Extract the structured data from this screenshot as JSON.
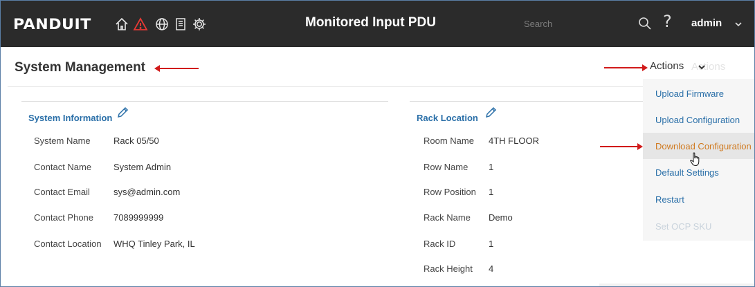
{
  "topbar": {
    "logo": "PANDUIT",
    "nav_icons": [
      "home-icon",
      "alert-icon",
      "globe-icon",
      "document-icon",
      "gear-icon"
    ],
    "title": "Monitored Input PDU",
    "search_placeholder": "Search",
    "user": "admin"
  },
  "page": {
    "title": "System Management"
  },
  "actions": {
    "label": "Actions",
    "ghost_label": "Actions",
    "items": [
      {
        "label": "Upload Firmware",
        "state": "normal"
      },
      {
        "label": "Upload Configuration",
        "state": "normal"
      },
      {
        "label": "Download Configuration",
        "state": "hover"
      },
      {
        "label": "Default Settings",
        "state": "normal"
      },
      {
        "label": "Restart",
        "state": "normal"
      },
      {
        "label": "Set OCP SKU",
        "state": "disabled"
      }
    ]
  },
  "system_info": {
    "title": "System Information",
    "rows": [
      {
        "label": "System Name",
        "value": "Rack 05/50"
      },
      {
        "label": "Contact Name",
        "value": "System Admin"
      },
      {
        "label": "Contact Email",
        "value": "sys@admin.com"
      },
      {
        "label": "Contact Phone",
        "value": "7089999999"
      },
      {
        "label": "Contact Location",
        "value": "WHQ Tinley Park, IL"
      }
    ]
  },
  "rack_location": {
    "title": "Rack Location",
    "rows": [
      {
        "label": "Room Name",
        "value": "4TH FLOOR"
      },
      {
        "label": "Row Name",
        "value": "1"
      },
      {
        "label": "Row Position",
        "value": "1"
      },
      {
        "label": "Rack Name",
        "value": "Demo"
      },
      {
        "label": "Rack ID",
        "value": "1"
      },
      {
        "label": "Rack Height",
        "value": "4"
      }
    ]
  },
  "colors": {
    "topbar_bg": "#2b2b2b",
    "link_blue": "#2a6fa8",
    "hover_orange": "#d07a20",
    "annotation_red": "#d11a1a"
  }
}
